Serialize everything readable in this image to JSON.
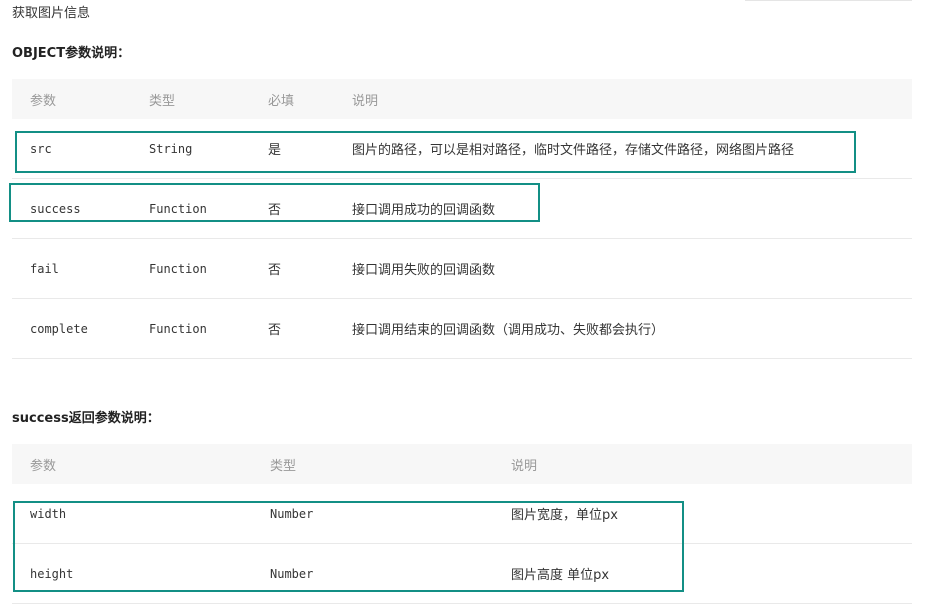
{
  "intro": "获取图片信息",
  "object_section": {
    "title": "OBJECT参数说明：",
    "headers": [
      "参数",
      "类型",
      "必填",
      "说明"
    ],
    "rows": [
      {
        "name": "src",
        "type": "String",
        "required": "是",
        "desc": "图片的路径，可以是相对路径，临时文件路径，存储文件路径，网络图片路径"
      },
      {
        "name": "success",
        "type": "Function",
        "required": "否",
        "desc": "接口调用成功的回调函数"
      },
      {
        "name": "fail",
        "type": "Function",
        "required": "否",
        "desc": "接口调用失败的回调函数"
      },
      {
        "name": "complete",
        "type": "Function",
        "required": "否",
        "desc": "接口调用结束的回调函数（调用成功、失败都会执行）"
      }
    ]
  },
  "success_section": {
    "title": "success返回参数说明：",
    "headers": [
      "参数",
      "类型",
      "说明"
    ],
    "rows": [
      {
        "name": "width",
        "type": "Number",
        "desc": "图片宽度，单位px"
      },
      {
        "name": "height",
        "type": "Number",
        "desc": "图片高度 单位px"
      }
    ]
  },
  "highlight_color": "#138f85"
}
